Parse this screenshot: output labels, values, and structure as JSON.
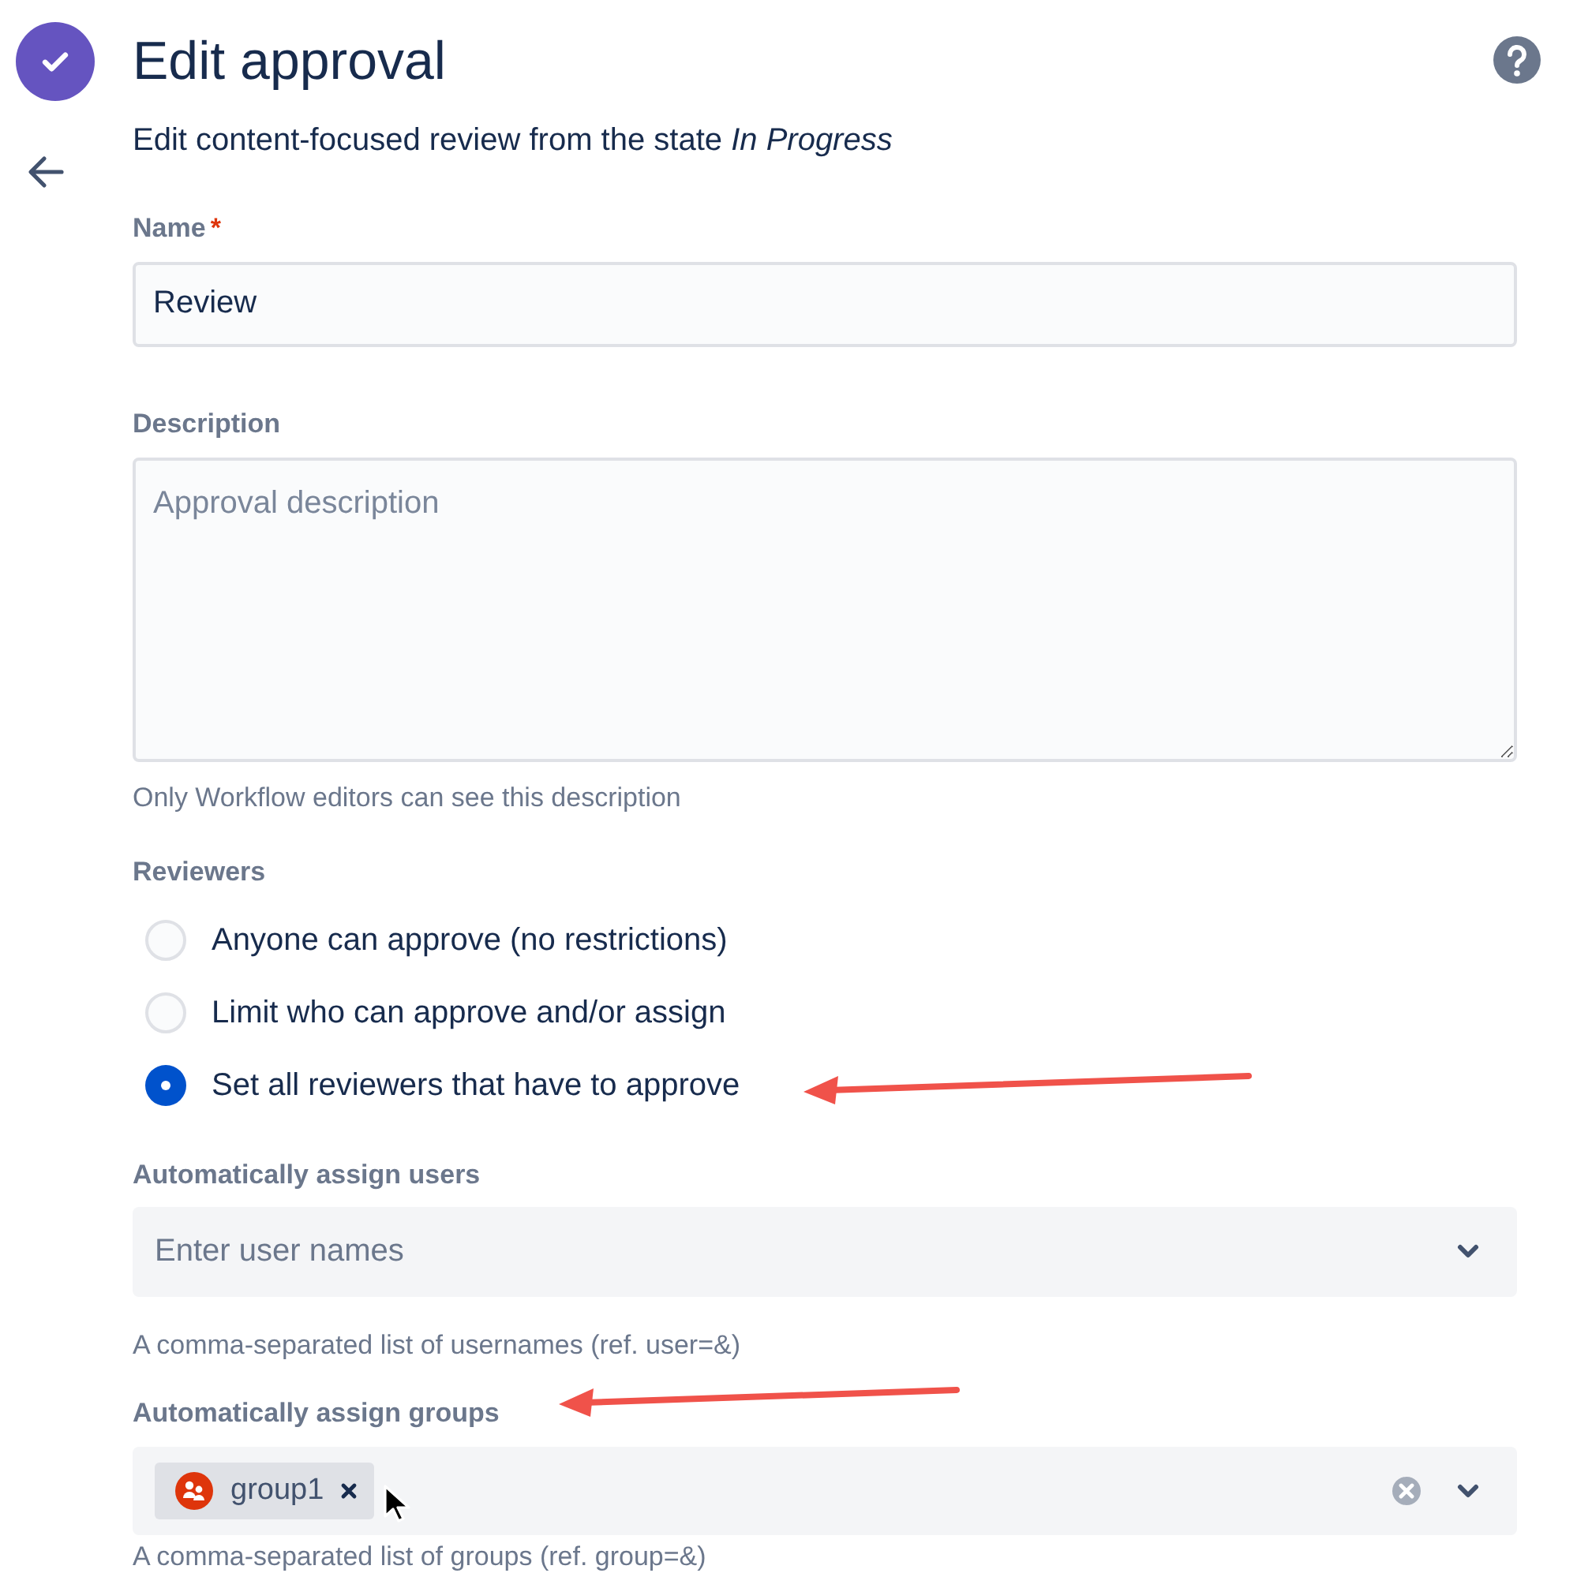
{
  "title": "Edit approval",
  "subtitle": "Edit content-focused review from the state *In Progress*",
  "name_field": {
    "label": "Name",
    "required": true,
    "required_mark": "*",
    "value": "Review"
  },
  "description_field": {
    "label": "Description",
    "placeholder": "Approval description",
    "hint": "Only Workflow editors can see this description"
  },
  "reviewers": {
    "label": "Reviewers",
    "options": [
      {
        "label": "Anyone can approve (no restrictions)",
        "selected": false
      },
      {
        "label": "Limit who can approve and/or assign",
        "selected": false
      },
      {
        "label": "Set all reviewers that have to approve",
        "selected": true
      }
    ]
  },
  "assign_users": {
    "label": "Automatically assign users",
    "placeholder": "Enter user names",
    "hint": "A comma-separated list of usernames (ref. user=&)"
  },
  "assign_groups": {
    "label": "Automatically assign groups",
    "tags": [
      "group1"
    ],
    "hint": "A comma-separated list of groups (ref. group=&)"
  }
}
